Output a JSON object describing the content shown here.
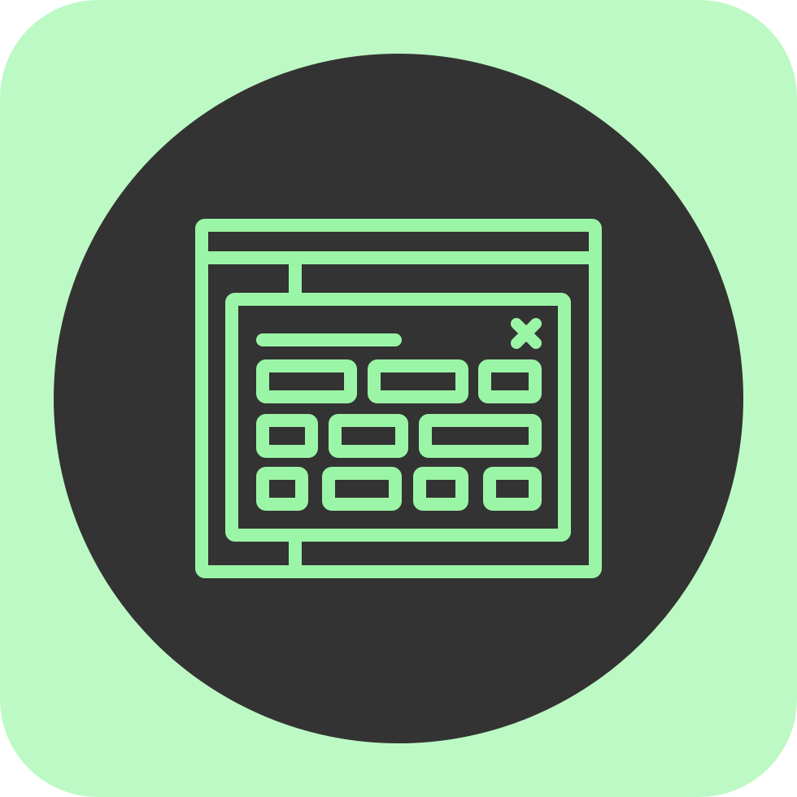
{
  "icon": {
    "name": "modal-dialog-window-icon",
    "colors": {
      "tile_background": "#BDF9C4",
      "circle_fill": "#333333",
      "line_stroke": "#9BF5A6"
    }
  }
}
